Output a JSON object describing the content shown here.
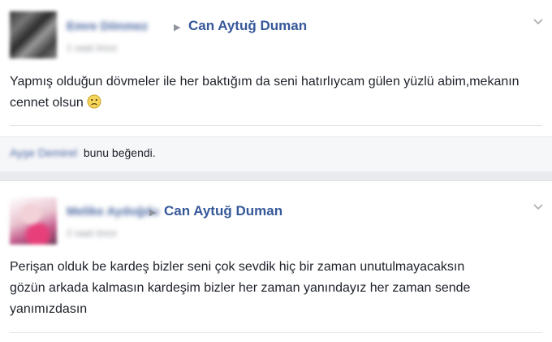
{
  "posts": [
    {
      "author_blurred": "Emre Dönmez",
      "target": "Can Aytuğ Duman",
      "time_blurred": "1 saat önce",
      "text": "Yapmış olduğun dövmeler ile her baktığım da seni hatırlıycam gülen yüzlü abim,mekanın cennet olsun",
      "emoji": "sad-face-icon",
      "likers_blurred": "Ayşe Demirel",
      "likes_text": "bunu beğendi."
    },
    {
      "author_blurred": "Melike Aydoğdu",
      "target": "Can Aytuğ Duman",
      "time_blurred": "2 saat önce",
      "text": "Perişan olduk be kardeş bizler seni çok sevdik hiç bir zaman unutulmayacaksın gözün arkada kalmasın kardeşim bizler her zaman yanındayız her zaman sende yanımızdasın"
    }
  ],
  "icons": {
    "arrow": "▶",
    "chevron": "chevron-down-icon"
  },
  "colors": {
    "link": "#365899",
    "background": "#e9ebee"
  }
}
